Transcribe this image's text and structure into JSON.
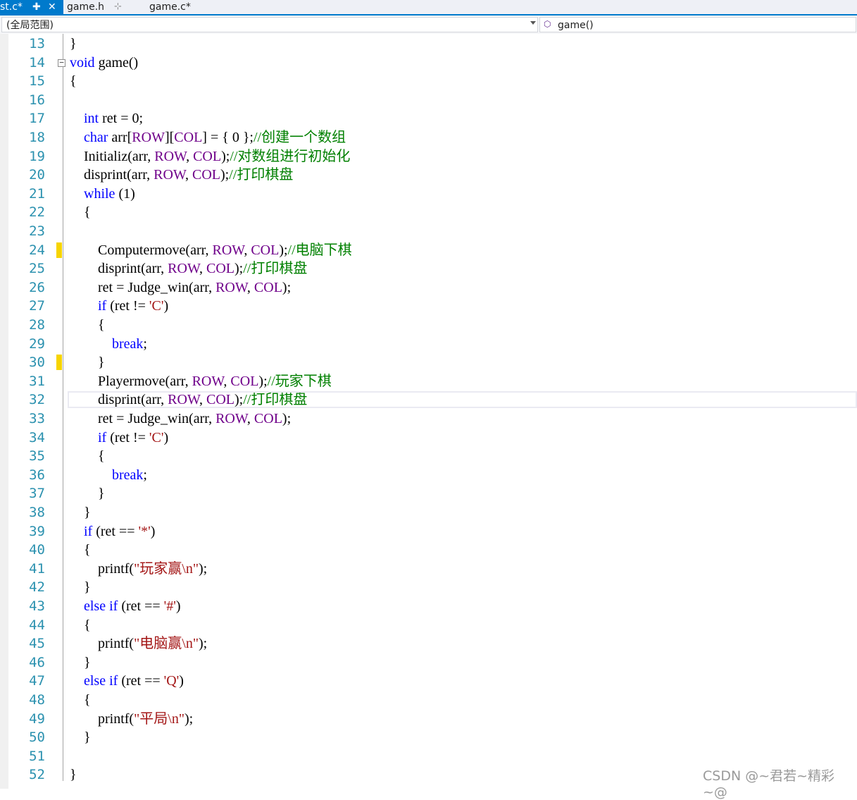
{
  "tabs": [
    {
      "label": "st.c*",
      "pin": "✚",
      "close": "✕",
      "active": true
    },
    {
      "label": "game.h",
      "pin": "⊹",
      "active": false
    },
    {
      "label": "game.c*",
      "active": false
    }
  ],
  "nav": {
    "scope": "(全局范围)",
    "function": "game()"
  },
  "editor": {
    "lines": [
      {
        "n": 13,
        "tokens": [
          {
            "t": "}"
          }
        ]
      },
      {
        "n": 14,
        "tokens": [
          {
            "t": "void",
            "c": "kw"
          },
          {
            "t": " game()"
          }
        ]
      },
      {
        "n": 15,
        "tokens": [
          {
            "t": "{"
          }
        ]
      },
      {
        "n": 16,
        "tokens": []
      },
      {
        "n": 17,
        "tokens": [
          {
            "t": "    "
          },
          {
            "t": "int",
            "c": "kw"
          },
          {
            "t": " ret = 0;"
          }
        ]
      },
      {
        "n": 18,
        "tokens": [
          {
            "t": "    "
          },
          {
            "t": "char",
            "c": "kw"
          },
          {
            "t": " arr["
          },
          {
            "t": "ROW",
            "c": "mac"
          },
          {
            "t": "]["
          },
          {
            "t": "COL",
            "c": "mac"
          },
          {
            "t": "] = { 0 };"
          },
          {
            "t": "//创建一个数组",
            "c": "cm"
          }
        ]
      },
      {
        "n": 19,
        "tokens": [
          {
            "t": "    Initializ(arr, "
          },
          {
            "t": "ROW",
            "c": "mac"
          },
          {
            "t": ", "
          },
          {
            "t": "COL",
            "c": "mac"
          },
          {
            "t": ");"
          },
          {
            "t": "//对数组进行初始化",
            "c": "cm"
          }
        ]
      },
      {
        "n": 20,
        "tokens": [
          {
            "t": "    disprint(arr, "
          },
          {
            "t": "ROW",
            "c": "mac"
          },
          {
            "t": ", "
          },
          {
            "t": "COL",
            "c": "mac"
          },
          {
            "t": ");"
          },
          {
            "t": "//打印棋盘",
            "c": "cm"
          }
        ]
      },
      {
        "n": 21,
        "tokens": [
          {
            "t": "    "
          },
          {
            "t": "while",
            "c": "kw"
          },
          {
            "t": " (1)"
          }
        ]
      },
      {
        "n": 22,
        "tokens": [
          {
            "t": "    {"
          }
        ]
      },
      {
        "n": 23,
        "tokens": []
      },
      {
        "n": 24,
        "tokens": [
          {
            "t": "        Computermove(arr, "
          },
          {
            "t": "ROW",
            "c": "mac"
          },
          {
            "t": ", "
          },
          {
            "t": "COL",
            "c": "mac"
          },
          {
            "t": ");"
          },
          {
            "t": "//电脑下棋",
            "c": "cm"
          }
        ]
      },
      {
        "n": 25,
        "tokens": [
          {
            "t": "        disprint(arr, "
          },
          {
            "t": "ROW",
            "c": "mac"
          },
          {
            "t": ", "
          },
          {
            "t": "COL",
            "c": "mac"
          },
          {
            "t": ");"
          },
          {
            "t": "//打印棋盘",
            "c": "cm"
          }
        ]
      },
      {
        "n": 26,
        "tokens": [
          {
            "t": "        ret = Judge_win(arr, "
          },
          {
            "t": "ROW",
            "c": "mac"
          },
          {
            "t": ", "
          },
          {
            "t": "COL",
            "c": "mac"
          },
          {
            "t": ");"
          }
        ]
      },
      {
        "n": 27,
        "tokens": [
          {
            "t": "        "
          },
          {
            "t": "if",
            "c": "kw"
          },
          {
            "t": " (ret != "
          },
          {
            "t": "'C'",
            "c": "str"
          },
          {
            "t": ")"
          }
        ]
      },
      {
        "n": 28,
        "tokens": [
          {
            "t": "        {"
          }
        ]
      },
      {
        "n": 29,
        "tokens": [
          {
            "t": "            "
          },
          {
            "t": "break",
            "c": "kw"
          },
          {
            "t": ";"
          }
        ]
      },
      {
        "n": 30,
        "tokens": [
          {
            "t": "        }"
          }
        ]
      },
      {
        "n": 31,
        "tokens": [
          {
            "t": "        Playermove(arr, "
          },
          {
            "t": "ROW",
            "c": "mac"
          },
          {
            "t": ", "
          },
          {
            "t": "COL",
            "c": "mac"
          },
          {
            "t": ");"
          },
          {
            "t": "//玩家下棋",
            "c": "cm"
          }
        ]
      },
      {
        "n": 32,
        "tokens": [
          {
            "t": "        disprint(arr, "
          },
          {
            "t": "ROW",
            "c": "mac"
          },
          {
            "t": ", "
          },
          {
            "t": "COL",
            "c": "mac"
          },
          {
            "t": ");"
          },
          {
            "t": "//打印棋盘",
            "c": "cm"
          }
        ]
      },
      {
        "n": 33,
        "tokens": [
          {
            "t": "        ret = Judge_win(arr, "
          },
          {
            "t": "ROW",
            "c": "mac"
          },
          {
            "t": ", "
          },
          {
            "t": "COL",
            "c": "mac"
          },
          {
            "t": ");"
          }
        ]
      },
      {
        "n": 34,
        "tokens": [
          {
            "t": "        "
          },
          {
            "t": "if",
            "c": "kw"
          },
          {
            "t": " (ret != "
          },
          {
            "t": "'C'",
            "c": "str"
          },
          {
            "t": ")"
          }
        ]
      },
      {
        "n": 35,
        "tokens": [
          {
            "t": "        {"
          }
        ]
      },
      {
        "n": 36,
        "tokens": [
          {
            "t": "            "
          },
          {
            "t": "break",
            "c": "kw"
          },
          {
            "t": ";"
          }
        ]
      },
      {
        "n": 37,
        "tokens": [
          {
            "t": "        }"
          }
        ]
      },
      {
        "n": 38,
        "tokens": [
          {
            "t": "    }"
          }
        ]
      },
      {
        "n": 39,
        "tokens": [
          {
            "t": "    "
          },
          {
            "t": "if",
            "c": "kw"
          },
          {
            "t": " (ret == "
          },
          {
            "t": "'*'",
            "c": "str"
          },
          {
            "t": ")"
          }
        ]
      },
      {
        "n": 40,
        "tokens": [
          {
            "t": "    {"
          }
        ]
      },
      {
        "n": 41,
        "tokens": [
          {
            "t": "        printf("
          },
          {
            "t": "\"玩家赢\\n\"",
            "c": "str"
          },
          {
            "t": ");"
          }
        ]
      },
      {
        "n": 42,
        "tokens": [
          {
            "t": "    }"
          }
        ]
      },
      {
        "n": 43,
        "tokens": [
          {
            "t": "    "
          },
          {
            "t": "else",
            "c": "kw"
          },
          {
            "t": " "
          },
          {
            "t": "if",
            "c": "kw"
          },
          {
            "t": " (ret == "
          },
          {
            "t": "'#'",
            "c": "str"
          },
          {
            "t": ")"
          }
        ]
      },
      {
        "n": 44,
        "tokens": [
          {
            "t": "    {"
          }
        ]
      },
      {
        "n": 45,
        "tokens": [
          {
            "t": "        printf("
          },
          {
            "t": "\"电脑赢\\n\"",
            "c": "str"
          },
          {
            "t": ");"
          }
        ]
      },
      {
        "n": 46,
        "tokens": [
          {
            "t": "    }"
          }
        ]
      },
      {
        "n": 47,
        "tokens": [
          {
            "t": "    "
          },
          {
            "t": "else",
            "c": "kw"
          },
          {
            "t": " "
          },
          {
            "t": "if",
            "c": "kw"
          },
          {
            "t": " (ret == "
          },
          {
            "t": "'Q'",
            "c": "str"
          },
          {
            "t": ")"
          }
        ]
      },
      {
        "n": 48,
        "tokens": [
          {
            "t": "    {"
          }
        ]
      },
      {
        "n": 49,
        "tokens": [
          {
            "t": "        printf("
          },
          {
            "t": "\"平局\\n\"",
            "c": "str"
          },
          {
            "t": ");"
          }
        ]
      },
      {
        "n": 50,
        "tokens": [
          {
            "t": "    }"
          }
        ]
      },
      {
        "n": 51,
        "tokens": []
      },
      {
        "n": 52,
        "tokens": [
          {
            "t": "}"
          }
        ]
      }
    ],
    "change_marks": [
      24,
      30
    ],
    "fold_marks": [
      {
        "line": 14,
        "symbol": "−"
      }
    ],
    "current_line": 32
  },
  "colors": {
    "accent": "#007acc",
    "keyword": "#0000ff",
    "macro": "#6f008a",
    "string": "#a31515",
    "comment": "#008000",
    "line_number": "#2b91af",
    "change_mark": "#f7d400"
  },
  "watermark": "CSDN @~君若~精彩~@"
}
